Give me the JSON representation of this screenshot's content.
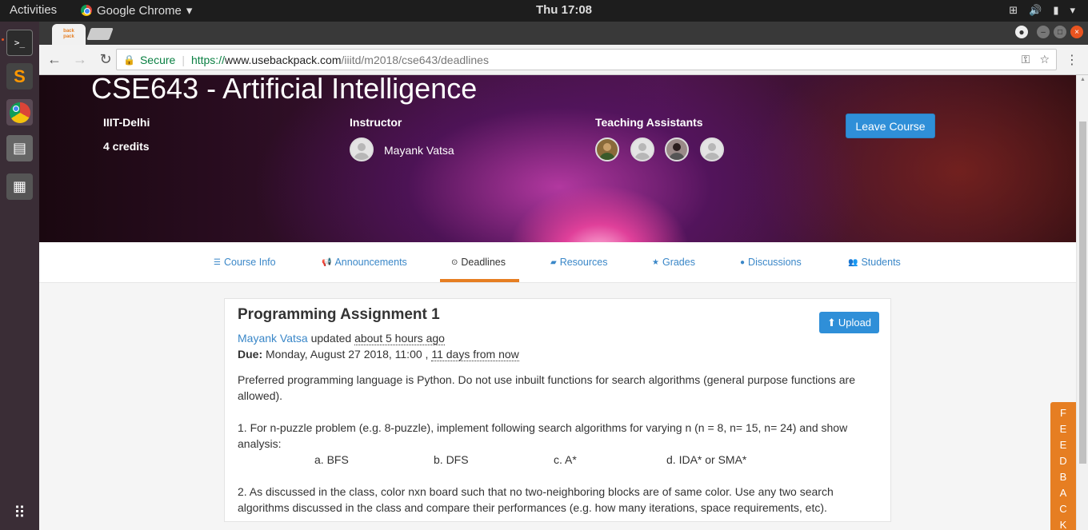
{
  "system": {
    "activities": "Activities",
    "app_name": "Google Chrome",
    "clock": "Thu 17:08"
  },
  "browser": {
    "tab_favicon_text": "back pack",
    "secure_label": "Secure",
    "url_protocol": "https://",
    "url_host": "www.usebackpack.com",
    "url_path": "/iiitd/m2018/cse643/deadlines"
  },
  "course": {
    "title": "CSE643 - Artificial Intelligence",
    "institute": "IIIT-Delhi",
    "credits": "4 credits",
    "instructor_label": "Instructor",
    "instructor_name": "Mayank Vatsa",
    "ta_label": "Teaching Assistants",
    "leave_button": "Leave Course"
  },
  "nav_tabs": [
    {
      "label": "Course Info",
      "icon": "list-icon"
    },
    {
      "label": "Announcements",
      "icon": "bullhorn-icon"
    },
    {
      "label": "Deadlines",
      "icon": "clock-icon",
      "active": true
    },
    {
      "label": "Resources",
      "icon": "book-icon"
    },
    {
      "label": "Grades",
      "icon": "star-icon"
    },
    {
      "label": "Discussions",
      "icon": "comment-icon"
    },
    {
      "label": "Students",
      "icon": "users-icon"
    }
  ],
  "deadline": {
    "title": "Programming Assignment 1",
    "upload_label": "Upload",
    "author": "Mayank Vatsa",
    "updated_text": "updated",
    "updated_ago": "about 5 hours ago",
    "due_label": "Due:",
    "due_date": "Monday, August 27 2018, 11:00 ,",
    "due_relative": "11 days from now",
    "para1": "Preferred programming language is Python. Do not use inbuilt functions for search algorithms (general purpose functions are allowed).",
    "item1": "1.    For n-puzzle problem (e.g. 8-puzzle), implement following search algorithms for varying n (n = 8, n= 15, n= 24) and show analysis:",
    "sub_items": [
      "a.    BFS",
      "b.    DFS",
      "c.    A*",
      "d.    IDA* or SMA*"
    ],
    "item2": "2.    As discussed in the class, color nxn board such that no two-neighboring blocks are of same color. Use any two search algorithms discussed in the class and compare their performances (e.g. how many iterations, space requirements, etc)."
  },
  "feedback_label": "FEEDBACK",
  "colors": {
    "accent": "#e67e22",
    "link": "#3a87c8",
    "primary_button": "#2f8fd8"
  }
}
